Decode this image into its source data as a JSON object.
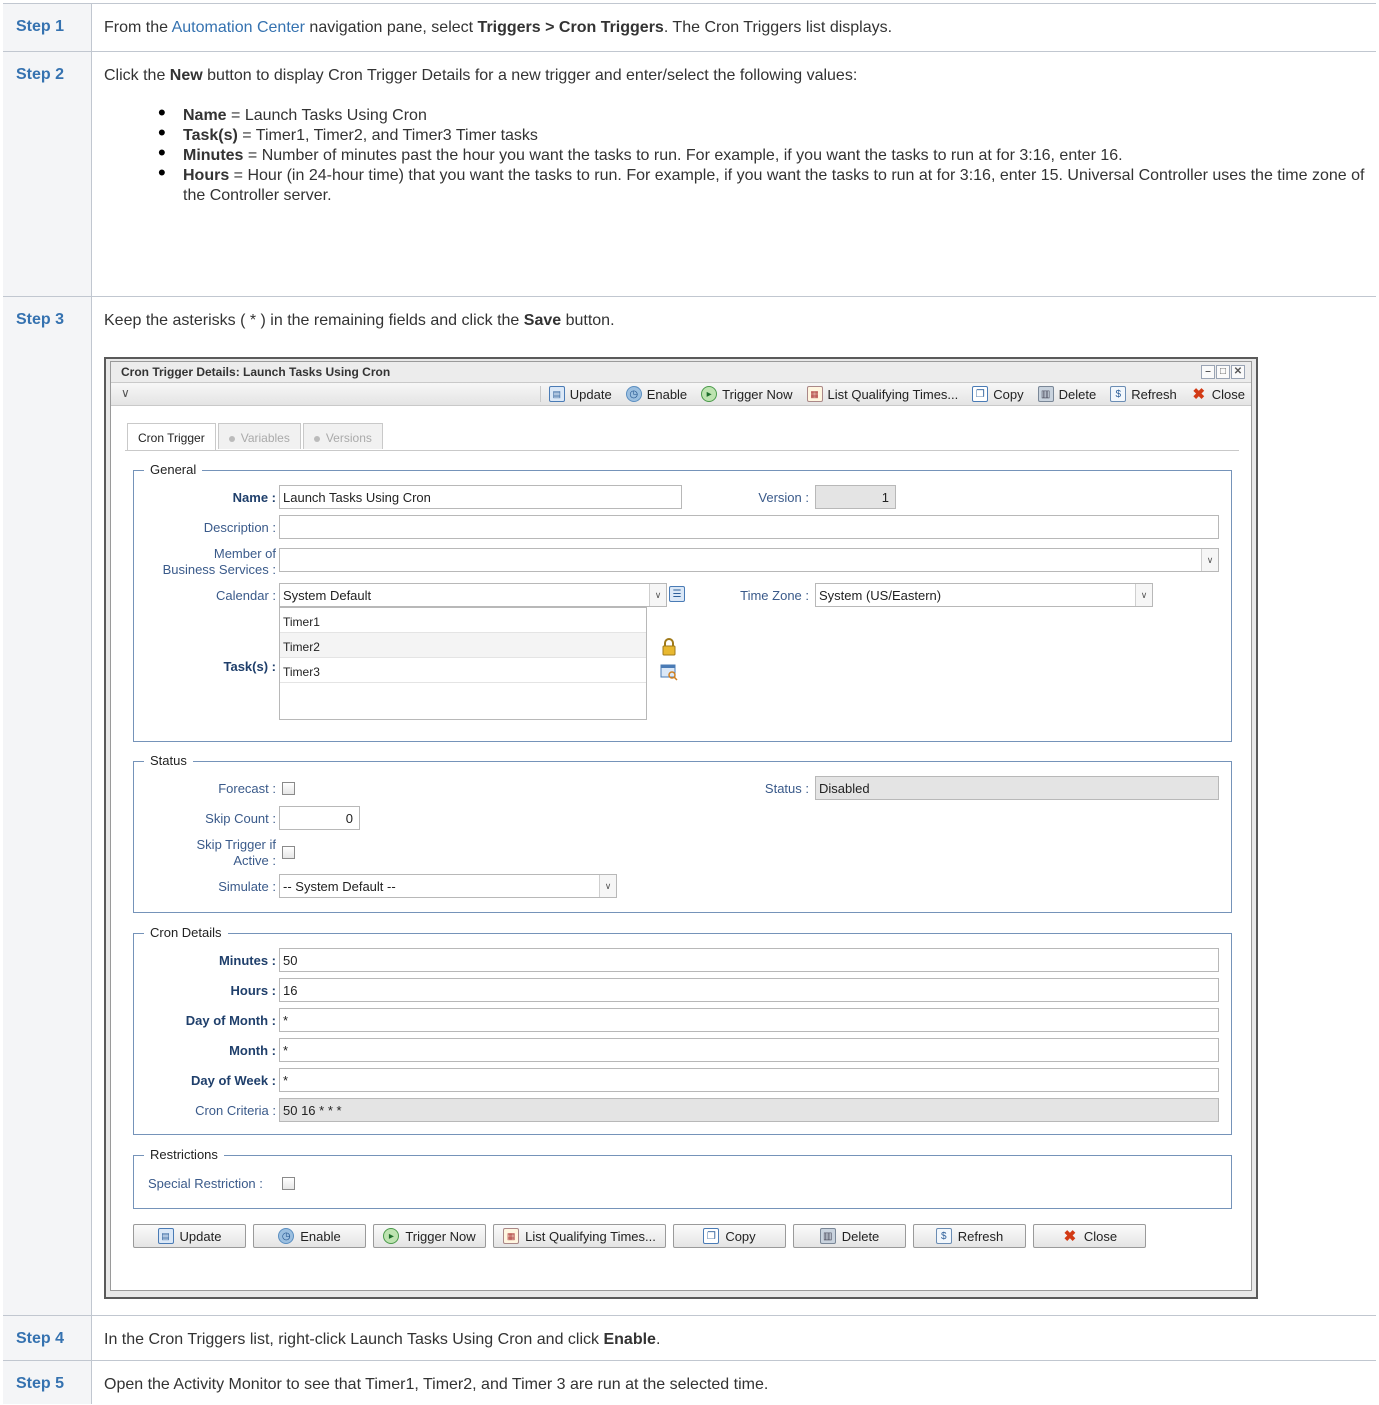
{
  "steps": [
    {
      "label": "Step 1",
      "link": "Automation Center",
      "pre": "From the ",
      "mid": " navigation pane, select ",
      "bold": "Triggers > Cron Triggers",
      "post": ". The Cron Triggers list displays."
    },
    {
      "label": "Step 2",
      "pre": "Click the ",
      "bold": "New",
      "post": " button to display Cron Trigger Details for a new trigger and enter/select the following values:",
      "items": [
        {
          "bold": "Name",
          "text": " = Launch Tasks Using Cron"
        },
        {
          "bold": "Task(s)",
          "text": " = Timer1, Timer2, and Timer3 Timer tasks"
        },
        {
          "bold": "Minutes",
          "text": " = Number of minutes past the hour you want the tasks to run. For example, if you want the tasks to run at for 3:16, enter 16."
        },
        {
          "bold": "Hours",
          "text": " = Hour (in 24-hour time) that you want the tasks to run. For example, if you want the tasks to run at for 3:16, enter 15. Universal Controller uses the time zone of the Controller server."
        }
      ]
    },
    {
      "label": "Step 3",
      "pre": "Keep the asterisks ( * ) in the remaining fields and click the ",
      "bold": "Save",
      "post": " button."
    },
    {
      "label": "Step 4",
      "pre": "In the Cron Triggers list, right-click Launch Tasks Using Cron and click ",
      "bold": "Enable",
      "post": "."
    },
    {
      "label": "Step 5",
      "pre": "Open the Activity Monitor to see that Timer1, Timer2, and Timer 3 are run at the selected time."
    }
  ],
  "window": {
    "title": "Cron Trigger Details: Launch Tasks Using Cron",
    "toolbar": [
      "Update",
      "Enable",
      "Trigger Now",
      "List Qualifying Times...",
      "Copy",
      "Delete",
      "Refresh",
      "Close"
    ],
    "tabs": [
      "Cron Trigger",
      "Variables",
      "Versions"
    ],
    "general": {
      "legend": "General",
      "name_label": "Name :",
      "name_value": "Launch Tasks Using Cron",
      "version_label": "Version :",
      "version_value": "1",
      "description_label": "Description :",
      "description_value": "",
      "member_label_1": "Member of",
      "member_label_2": "Business Services :",
      "member_value": "",
      "calendar_label": "Calendar :",
      "calendar_value": "System Default",
      "timezone_label": "Time Zone :",
      "timezone_value": "System (US/Eastern)",
      "tasks_label": "Task(s) :",
      "tasks": [
        "Timer1",
        "Timer2",
        "Timer3"
      ]
    },
    "status": {
      "legend": "Status",
      "forecast_label": "Forecast :",
      "status_label": "Status :",
      "status_value": "Disabled",
      "skip_count_label": "Skip Count :",
      "skip_count_value": "0",
      "skip_active_label_1": "Skip Trigger if",
      "skip_active_label_2": "Active :",
      "simulate_label": "Simulate :",
      "simulate_value": "-- System Default --"
    },
    "cron": {
      "legend": "Cron Details",
      "minutes_label": "Minutes :",
      "minutes_value": "50",
      "hours_label": "Hours :",
      "hours_value": "16",
      "dom_label": "Day of Month :",
      "dom_value": "*",
      "month_label": "Month :",
      "month_value": "*",
      "dow_label": "Day of Week :",
      "dow_value": "*",
      "criteria_label": "Cron Criteria :",
      "criteria_value": "50 16 * * *"
    },
    "restrictions": {
      "legend": "Restrictions",
      "special_label": "Special Restriction :"
    },
    "buttons": [
      "Update",
      "Enable",
      "Trigger Now",
      "List Qualifying Times...",
      "Copy",
      "Delete",
      "Refresh",
      "Close"
    ]
  }
}
